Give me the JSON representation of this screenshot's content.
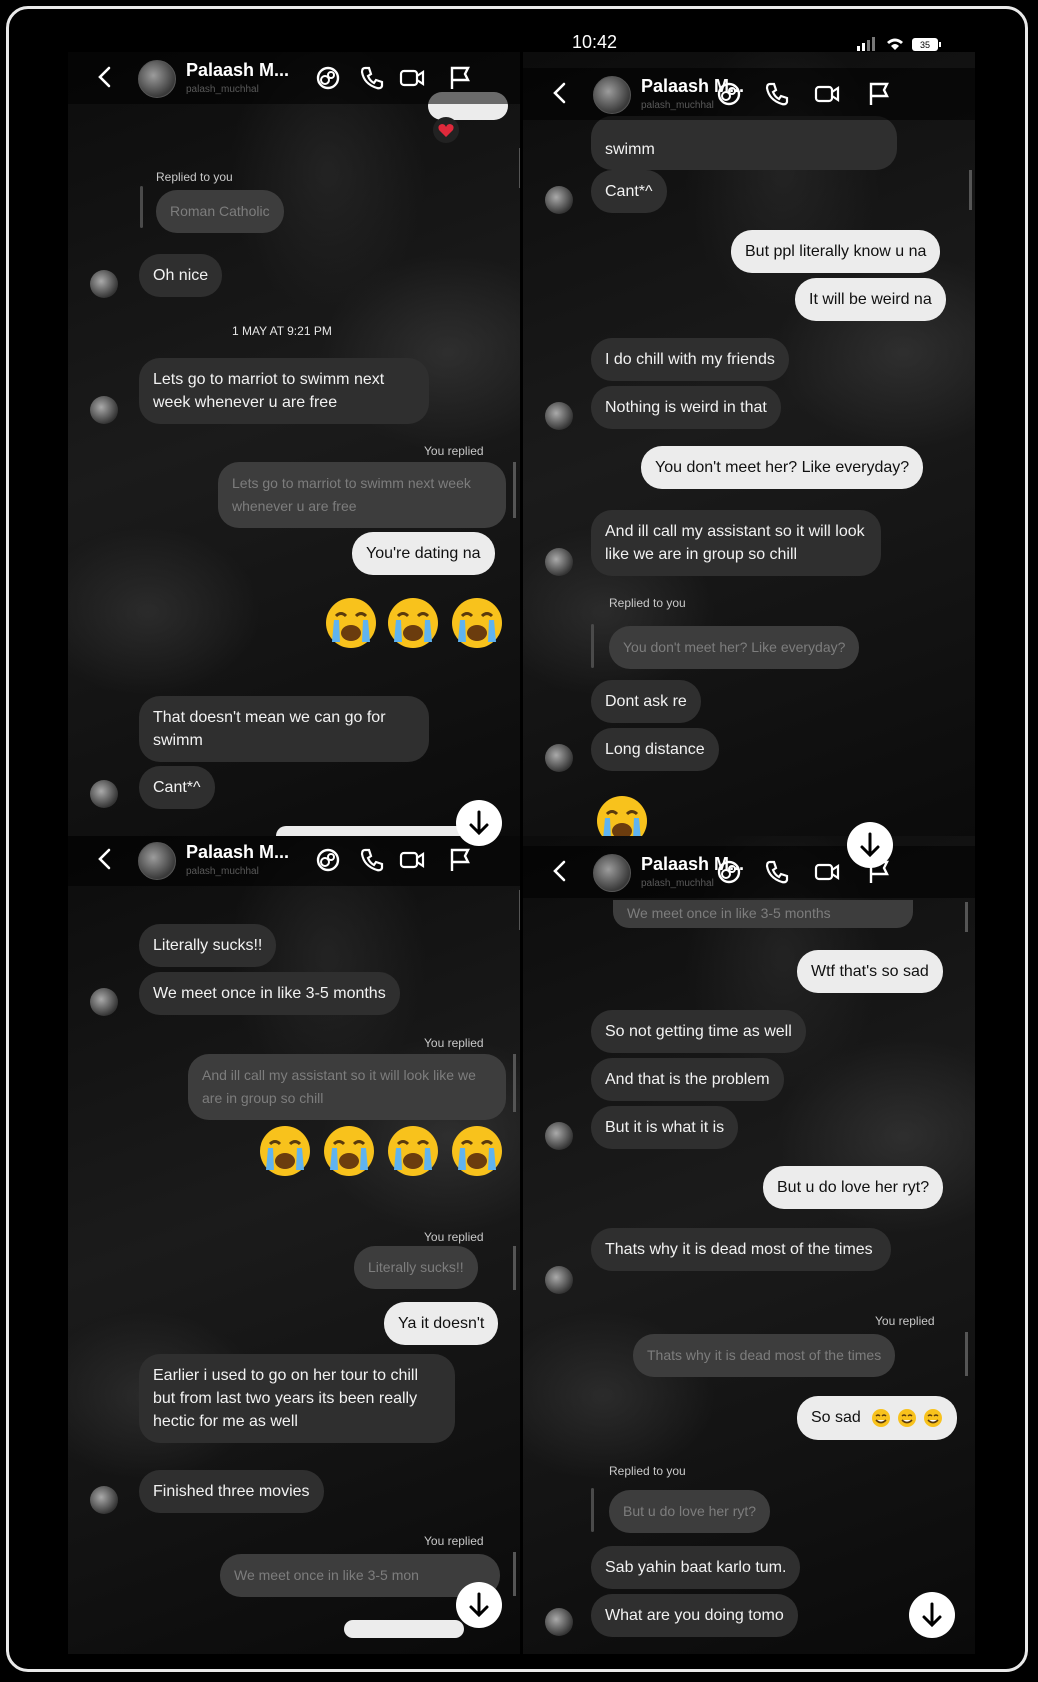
{
  "status_bar": {
    "time": "10:42",
    "battery": "35"
  },
  "contact": {
    "name": "Palaash M...",
    "username": "palash_muchhal"
  },
  "labels": {
    "replied_to_you": "Replied to you",
    "you_replied": "You replied"
  },
  "panel1": {
    "quote_roman": "Roman Catholic",
    "oh_nice": "Oh nice",
    "timestamp": "1 MAY AT 9:21 PM",
    "marriot": "Lets go to marriot to swimm next week whenever u are free",
    "quote_marriot": "Lets go to marriot to swimm next week whenever u are free",
    "dating": "You're dating na",
    "doesnt_mean": "That doesn't mean we can go for swimm",
    "cant": "Cant*^"
  },
  "panel2": {
    "swimm": "swimm",
    "cant": "Cant*^",
    "ppl": "But ppl literally know u na",
    "weird": "It will be weird na",
    "chill": "I do chill with my friends",
    "nothing": "Nothing is weird in that",
    "dont_meet": "You don't meet her? Like everyday?",
    "assistant": "And ill call my assistant so it will look like we are in group so chill",
    "quote_dont_meet": "You don't meet her? Like everyday?",
    "dont_ask": "Dont ask re",
    "long_distance": "Long distance"
  },
  "panel3": {
    "sucks": "Literally sucks!!",
    "we_meet": "We meet  once in like 3-5 months",
    "quote_assistant": "And ill call my assistant so it will look like we are in group so chill",
    "quote_sucks": "Literally sucks!!",
    "ya": "Ya it doesn't",
    "earlier": "Earlier i used to go on her tour to chill but from last two years its been really hectic for me as well",
    "movies": "Finished three movies",
    "quote_we_meet": "We meet  once in like 3-5 mon"
  },
  "panel4": {
    "quote_top": "We meet  once in like 3-5 months",
    "wtf": "Wtf that's so sad",
    "so_not": "So not getting time as well",
    "problem": "And that is the problem",
    "it_is": "But it is what it is",
    "love": "But u do love her ryt?",
    "dead": "Thats why it is dead most of the times",
    "quote_dead": "Thats why it is dead most of the times",
    "so_sad": "So sad",
    "quote_love": "But u do love her ryt?",
    "sab": "Sab yahin baat karlo tum.",
    "tomo": "What are you doing tomo"
  },
  "icons": [
    "back-arrow-icon",
    "avatar",
    "sticker-icon",
    "phone-icon",
    "video-icon",
    "flag-icon",
    "crying-emoji-icon",
    "sweat-smile-emoji-icon",
    "heart-icon",
    "scroll-down-arrow-icon"
  ],
  "colors": {
    "received": "#2f2f2f",
    "sent": "#ececec",
    "background": "#000000"
  }
}
